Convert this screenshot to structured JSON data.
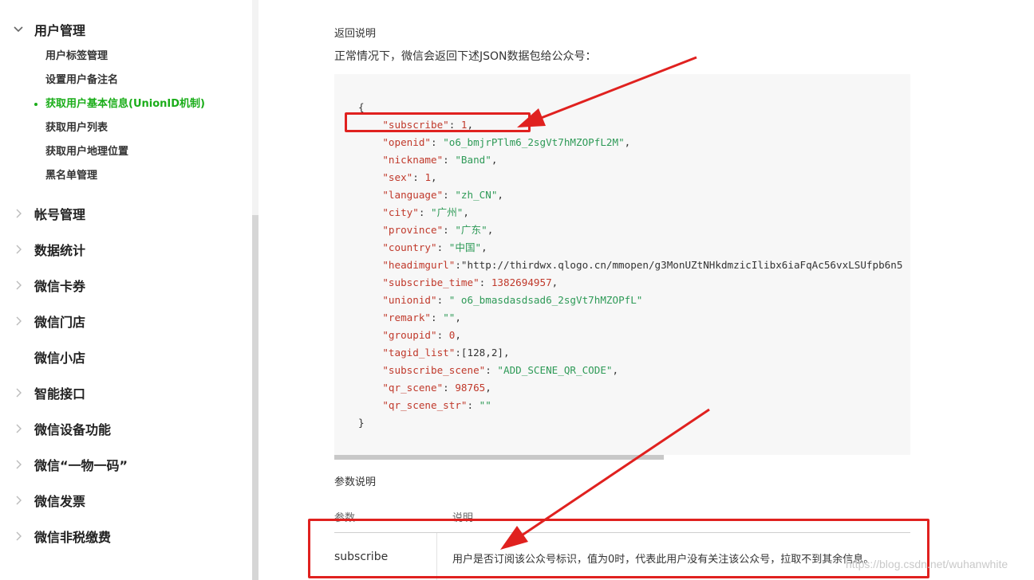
{
  "sidebar": {
    "groups": [
      {
        "label": "用户管理",
        "expanded": true
      },
      {
        "label": "帐号管理"
      },
      {
        "label": "数据统计"
      },
      {
        "label": "微信卡券"
      },
      {
        "label": "微信门店"
      },
      {
        "label": "微信小店"
      },
      {
        "label": "智能接口"
      },
      {
        "label": "微信设备功能"
      },
      {
        "label": "微信“一物一码”"
      },
      {
        "label": "微信发票"
      },
      {
        "label": "微信非税缴费"
      }
    ],
    "sub_items": [
      {
        "label": "用户标签管理"
      },
      {
        "label": "设置用户备注名"
      },
      {
        "label": "获取用户基本信息(UnionID机制)",
        "active": true
      },
      {
        "label": "获取用户列表"
      },
      {
        "label": "获取用户地理位置"
      },
      {
        "label": "黑名单管理"
      }
    ]
  },
  "main": {
    "return_title": "返回说明",
    "return_desc": "正常情况下，微信会返回下述JSON数据包给公众号：",
    "code_lines": [
      "{",
      "    \"subscribe\": 1,",
      "    \"openid\": \"o6_bmjrPTlm6_2sgVt7hMZOPfL2M\",",
      "    \"nickname\": \"Band\",",
      "    \"sex\": 1,",
      "    \"language\": \"zh_CN\",",
      "    \"city\": \"广州\",",
      "    \"province\": \"广东\",",
      "    \"country\": \"中国\",",
      "    \"headimgurl\":\"http://thirdwx.qlogo.cn/mmopen/g3MonUZtNHkdmzicIlibx6iaFqAc56vxLSUfpb6n5",
      "    \"subscribe_time\": 1382694957,",
      "    \"unionid\": \" o6_bmasdasdsad6_2sgVt7hMZOPfL\"",
      "    \"remark\": \"\",",
      "    \"groupid\": 0,",
      "    \"tagid_list\":[128,2],",
      "    \"subscribe_scene\": \"ADD_SCENE_QR_CODE\",",
      "    \"qr_scene\": 98765,",
      "    \"qr_scene_str\": \"\"",
      "}"
    ],
    "param_title": "参数说明",
    "table": {
      "headers": [
        "参数",
        "说明"
      ],
      "rows": [
        [
          "subscribe",
          "用户是否订阅该公众号标识，值为0时，代表此用户没有关注该公众号，拉取不到其余信息。"
        ]
      ]
    }
  },
  "watermark": "https://blog.csdn.net/wuhanwhite",
  "colors": {
    "accent_green": "#1aad19",
    "annotation_red": "#e0211f",
    "code_bg": "#f7f7f7"
  }
}
